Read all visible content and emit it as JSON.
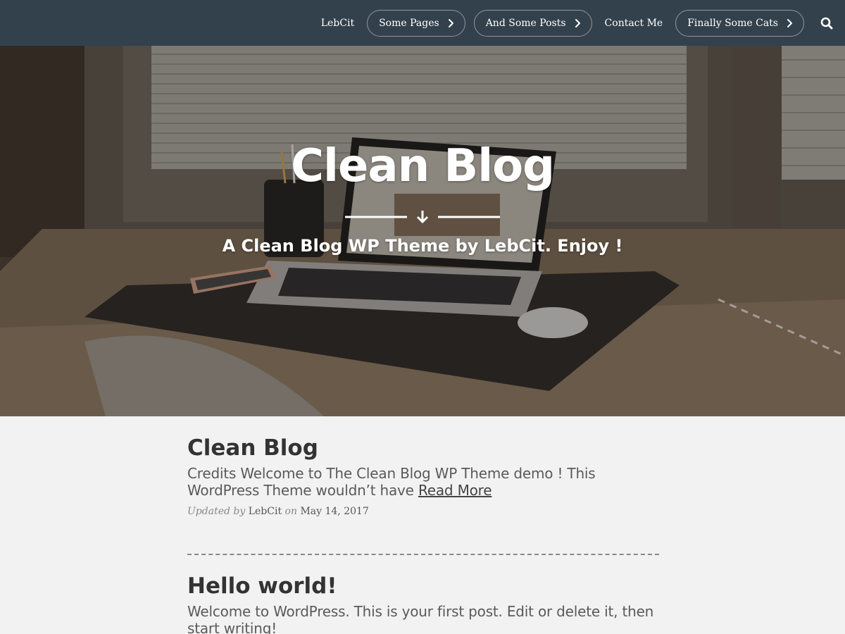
{
  "nav": {
    "items": [
      {
        "label": "LebCit",
        "has_submenu": false
      },
      {
        "label": "Some Pages",
        "has_submenu": true
      },
      {
        "label": "And Some Posts",
        "has_submenu": true
      },
      {
        "label": "Contact Me",
        "has_submenu": false
      },
      {
        "label": "Finally Some Cats",
        "has_submenu": true
      }
    ],
    "search_icon": "search-icon",
    "background_color": "#33414c"
  },
  "hero": {
    "title": "Clean Blog",
    "subtitle": "A Clean Blog WP Theme by LebCit. Enjoy !",
    "divider_icon": "arrow-down-icon"
  },
  "posts": [
    {
      "title": "Clean Blog",
      "excerpt_line1": "Credits Welcome to The Clean Blog WP Theme demo ! This",
      "excerpt_line2": "WordPress Theme wouldn’t have",
      "read_more": "Read More",
      "meta_prefix": "Updated by",
      "author": "LebCit",
      "meta_on": "on",
      "date": "May 14, 2017"
    },
    {
      "title": "Hello world!",
      "excerpt_line1": "Welcome to WordPress. This is your first post. Edit or delete it, then",
      "excerpt_line2": "start writing!"
    }
  ]
}
